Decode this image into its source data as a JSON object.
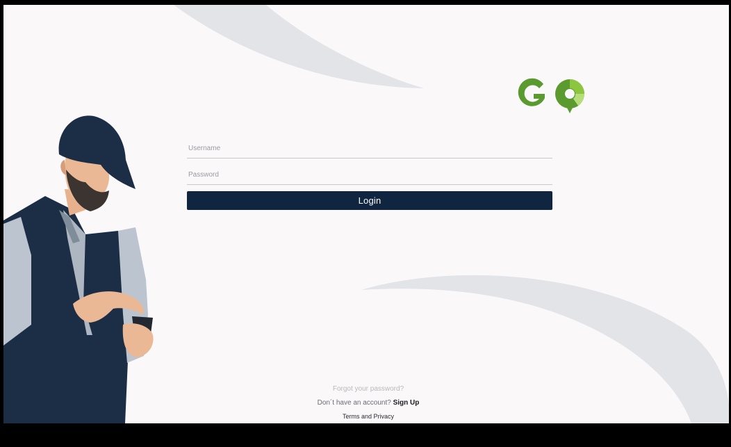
{
  "logo": {
    "text": "GO",
    "brand_green": "#5a9a2e",
    "light_green": "#8cc63f"
  },
  "form": {
    "username_placeholder": "Username",
    "password_placeholder": "Password",
    "login_label": "Login"
  },
  "footer": {
    "forgot_label": "Forgot your password?",
    "no_account_text": "Don´t have an account?",
    "signup_label": "Sign Up",
    "terms_label": "Terms and Privacy"
  },
  "colors": {
    "background": "#fbf8fa",
    "button": "#0f2540",
    "decor_shape": "#e3e4e7",
    "frame": "#000000"
  }
}
